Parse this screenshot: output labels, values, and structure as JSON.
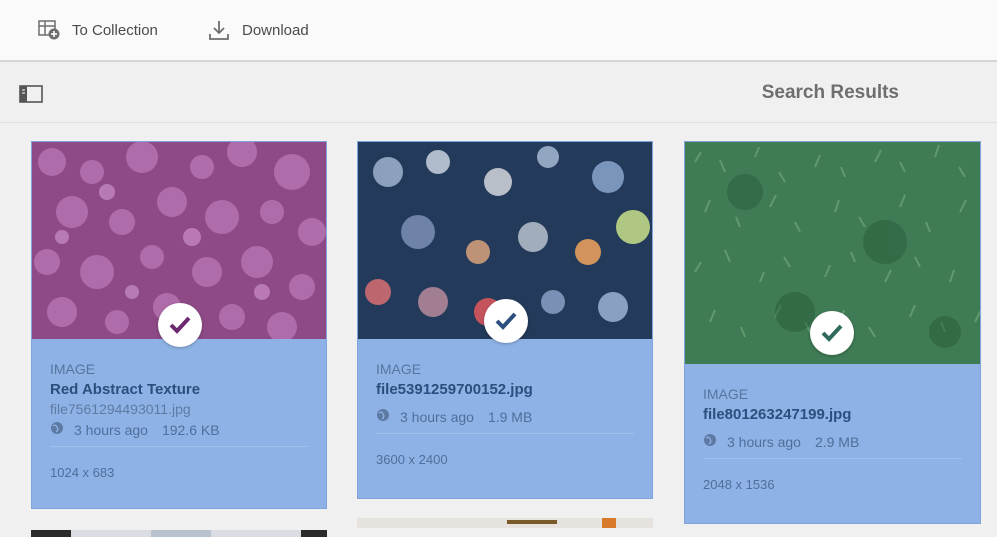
{
  "toolbar": {
    "collection_label": "To Collection",
    "download_label": "Download"
  },
  "header": {
    "title": "Search Results"
  },
  "cards": [
    {
      "type": "IMAGE",
      "title": "Red Abstract Texture",
      "filename": "file7561294493011.jpg",
      "time": "3 hours ago",
      "size": "192.6 KB",
      "dimensions": "1024 x 683",
      "selected": true
    },
    {
      "type": "IMAGE",
      "title": "file5391259700152.jpg",
      "time": "3 hours ago",
      "size": "1.9 MB",
      "dimensions": "3600 x 2400",
      "selected": true
    },
    {
      "type": "IMAGE",
      "title": "file801263247199.jpg",
      "time": "3 hours ago",
      "size": "2.9 MB",
      "dimensions": "2048 x 1536",
      "selected": true
    }
  ],
  "colors": {
    "selection": "#8fb2e6",
    "check": "#2c4f7d",
    "check_purple": "#6b2a6e",
    "check_green": "#2f6b5c"
  },
  "icons": [
    "add-to-collection-icon",
    "download-icon",
    "rail-toggle-icon",
    "check-icon",
    "globe-icon"
  ]
}
